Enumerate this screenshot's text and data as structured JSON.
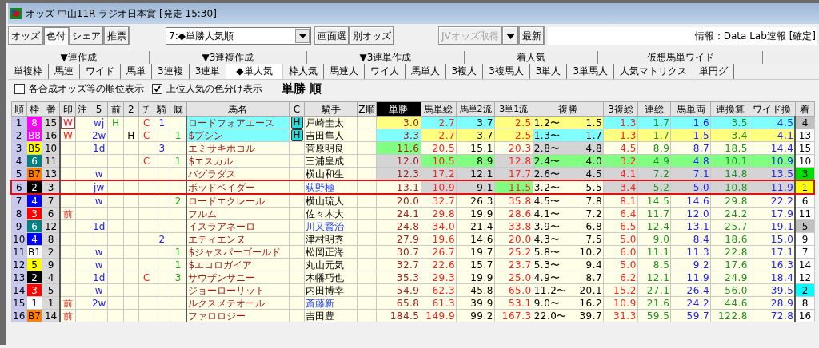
{
  "window": {
    "title": "オッズ 中山11R ラジオ日本賞 [発走 15:30]"
  },
  "toolbar": {
    "mode_buttons": [
      {
        "label": "オッズ",
        "selected": false
      },
      {
        "label": "色付",
        "selected": true
      },
      {
        "label": "シェア",
        "selected": false
      },
      {
        "label": "推票",
        "selected": false
      }
    ],
    "view_select": {
      "value": "7:◆単勝人気順"
    },
    "view_buttons": [
      {
        "label": "画面選",
        "disabled": false
      },
      {
        "label": "別オッズ",
        "disabled": false
      }
    ],
    "fetch_button": {
      "label": "JVオッズ取得",
      "disabled": true
    },
    "refresh_button": {
      "label": "最新",
      "disabled": false
    },
    "info": "情報：Data Lab速報 [確定]"
  },
  "tab_groups": [
    {
      "label": "▼連作成"
    },
    {
      "label": "▼3連複作成"
    },
    {
      "label": "▼3連単作成"
    },
    {
      "label": "着人気"
    },
    {
      "label": "仮想馬単ワイド"
    }
  ],
  "tabs": [
    {
      "label": "単複枠",
      "selected": false
    },
    {
      "label": "馬連",
      "selected": false
    },
    {
      "label": "ワイド",
      "selected": false
    },
    {
      "label": "馬単",
      "selected": false
    },
    {
      "label": "3連複",
      "selected": false
    },
    {
      "label": "3連単",
      "selected": false
    },
    {
      "label": "◆単人気",
      "selected": true
    },
    {
      "label": "枠人気",
      "selected": false
    },
    {
      "label": "馬連人",
      "selected": false
    },
    {
      "label": "ワイ人",
      "selected": false
    },
    {
      "label": "馬単人",
      "selected": false
    },
    {
      "label": "3複人",
      "selected": false
    },
    {
      "label": "3複馬人",
      "selected": false
    },
    {
      "label": "3単人",
      "selected": false
    },
    {
      "label": "3単馬人",
      "selected": false
    },
    {
      "label": "人気マトリクス",
      "selected": false
    },
    {
      "label": "単円グ",
      "selected": false
    }
  ],
  "options": {
    "checkboxes": [
      {
        "label": "各合成オッズ等の順位表示",
        "checked": false
      },
      {
        "label": "上位人気の色分け表示",
        "checked": true
      }
    ],
    "heading": "単勝 順"
  },
  "table": {
    "columns": [
      {
        "label": "順",
        "sorted": false
      },
      {
        "label": "枠",
        "sorted": false
      },
      {
        "label": "番",
        "sorted": false
      },
      {
        "label": "印",
        "sorted": false
      },
      {
        "label": "注",
        "sorted": false
      },
      {
        "label": "5",
        "sorted": false
      },
      {
        "label": "前",
        "sorted": false
      },
      {
        "label": "2",
        "sorted": false
      },
      {
        "label": "チ",
        "sorted": false
      },
      {
        "label": "騎",
        "sorted": false
      },
      {
        "label": "厩",
        "sorted": false
      },
      {
        "label": "馬名",
        "sorted": false
      },
      {
        "label": "C",
        "sorted": false
      },
      {
        "label": "騎手",
        "sorted": false
      },
      {
        "label": "Z順",
        "sorted": false
      },
      {
        "label": "単勝",
        "sorted": true
      },
      {
        "label": "馬単総",
        "sorted": false
      },
      {
        "label": "馬単2流",
        "sorted": false
      },
      {
        "label": "3単1流",
        "sorted": false
      },
      {
        "label": "複勝",
        "sorted": false
      },
      {
        "label": "3複総",
        "sorted": false
      },
      {
        "label": "連総",
        "sorted": false
      },
      {
        "label": "馬単両",
        "sorted": false
      },
      {
        "label": "連換算",
        "sorted": false
      },
      {
        "label": "ワイド換",
        "sorted": false
      },
      {
        "label": "着",
        "sorted": false
      }
    ],
    "rows": [
      {
        "rank": "1",
        "waku": {
          "text": "8",
          "color": "#ff00ff"
        },
        "num": "15",
        "mark": {
          "text": "W",
          "boxed": true
        },
        "marks": {
          "go": "wj",
          "mae": "H",
          "chi": "C",
          "ki": "1"
        },
        "name": "ロードフォアエース",
        "name_highlight": true,
        "c": "H",
        "jockey": "戸崎圭太",
        "jockey_marked": false,
        "odds": [
          {
            "value": "3.0",
            "color": "#ffff80"
          },
          {
            "value": "2.7",
            "color": "#80ffff"
          },
          {
            "value": "3.7",
            "color": "#80ffff"
          },
          {
            "value": "2.5",
            "color": "#ffff80"
          },
          {
            "low": "1.2〜",
            "high": "1.5",
            "color": "#ffff80"
          },
          {
            "value": "1.3",
            "color": "#80ffff"
          },
          {
            "value": "1.7",
            "color": "#80ffff"
          },
          {
            "value": "1.6",
            "color": "#80ffff"
          },
          {
            "value": "3.5",
            "color": "#80ffff"
          },
          {
            "value": "4.5",
            "color": "#80ffff"
          }
        ],
        "finish": {
          "text": "4",
          "color": "#c0c0c0"
        },
        "selected": false
      },
      {
        "rank": "2",
        "waku": {
          "text": "B8",
          "color": "#ff00ff"
        },
        "num": "16",
        "mark": {
          "text": "W",
          "boxed": false
        },
        "marks": {
          "go": "2w",
          "ni": "H",
          "chi": "C",
          "kyu": "1"
        },
        "name": "$ブシン",
        "name_highlight": true,
        "c": "H",
        "jockey": "吉田隼人",
        "jockey_marked": false,
        "odds": [
          {
            "value": "3.3",
            "color": "#80ffff"
          },
          {
            "value": "2.7",
            "color": "#ffff80"
          },
          {
            "value": "3.7",
            "color": "#ffff80"
          },
          {
            "value": "2.5",
            "color": "#ffff80"
          },
          {
            "low": "1.3〜",
            "high": "1.7",
            "color": "#80ffff"
          },
          {
            "value": "1.3",
            "color": "#ffff80"
          },
          {
            "value": "1.7",
            "color": "#ffff80"
          },
          {
            "value": "1.5",
            "color": "#ffff80"
          },
          {
            "value": "3.4",
            "color": "#ffff80"
          },
          {
            "value": "4.1",
            "color": "#ffff80"
          }
        ],
        "finish": {
          "text": "13",
          "color": "#ffffff"
        },
        "selected": false
      },
      {
        "rank": "3",
        "waku": {
          "text": "B5",
          "color": "#ffff00"
        },
        "num": "10",
        "marks": {
          "go": "1d",
          "ki": "3"
        },
        "name": "エミサキホコル",
        "name_highlight": false,
        "jockey": "菅原明良",
        "jockey_marked": false,
        "odds": [
          {
            "value": "11.6",
            "color": "#80ff80"
          },
          {
            "value": "20.5",
            "color": "#ffffe8"
          },
          {
            "value": "15.1",
            "color": "#ffffe8"
          },
          {
            "value": "20.3",
            "color": "#ffffe8"
          },
          {
            "low": "2.8〜",
            "high": "4.8",
            "color": "#d4d4d4"
          },
          {
            "value": "4.5",
            "color": "#ffffe8"
          },
          {
            "value": "8.9",
            "color": "#ffffe8"
          },
          {
            "value": "8.7",
            "color": "#ffffe8"
          },
          {
            "value": "18.5",
            "color": "#ffffe8"
          },
          {
            "value": "14.4",
            "color": "#ffffe8"
          }
        ],
        "finish": {
          "text": "15",
          "color": "#ffffff"
        },
        "selected": false
      },
      {
        "rank": "4",
        "waku": {
          "text": "6",
          "color": "#008080"
        },
        "num": "11",
        "marks": {
          "chi": "C",
          "kyu": "1"
        },
        "name": "$エスカル",
        "name_highlight": false,
        "jockey": "三浦皇成",
        "jockey_marked": false,
        "odds": [
          {
            "value": "12.0",
            "color": "#d4d4d4"
          },
          {
            "value": "10.5",
            "color": "#80ff80"
          },
          {
            "value": "8.9",
            "color": "#80ff80"
          },
          {
            "value": "12.8",
            "color": "#d4d4d4"
          },
          {
            "low": "2.4〜",
            "high": "4.0",
            "color": "#80ff80"
          },
          {
            "value": "3.2",
            "color": "#80ff80"
          },
          {
            "value": "4.9",
            "color": "#80ff80"
          },
          {
            "value": "4.8",
            "color": "#80ff80"
          },
          {
            "value": "10.1",
            "color": "#80ff80"
          },
          {
            "value": "10.9",
            "color": "#80ff80"
          }
        ],
        "finish": {
          "text": "10",
          "color": "#ffffff"
        },
        "selected": false
      },
      {
        "rank": "5",
        "waku": {
          "text": "B7",
          "color": "#ff8000"
        },
        "num": "13",
        "marks": {
          "go": "w"
        },
        "name": "バグラダス",
        "name_highlight": false,
        "jockey": "横山和生",
        "jockey_marked": false,
        "odds": [
          {
            "value": "12.3",
            "color": "#d4d4d4"
          },
          {
            "value": "17.2",
            "color": "#d4d4d4"
          },
          {
            "value": "12.1",
            "color": "#d4d4d4"
          },
          {
            "value": "17.7",
            "color": "#d4d4d4"
          },
          {
            "low": "2.6〜",
            "high": "4.5",
            "color": "#d4d4d4"
          },
          {
            "value": "4.1",
            "color": "#d4d4d4"
          },
          {
            "value": "7.2",
            "color": "#d4d4d4"
          },
          {
            "value": "7.1",
            "color": "#d4d4d4"
          },
          {
            "value": "14.8",
            "color": "#d4d4d4"
          },
          {
            "value": "13.5",
            "color": "#d4d4d4"
          }
        ],
        "finish": {
          "text": "3",
          "color": "#00e000"
        },
        "selected": false
      },
      {
        "rank": "6",
        "waku": {
          "text": "2",
          "color": "#000000"
        },
        "num": "3",
        "marks": {
          "go": "jw"
        },
        "name": "ボッドベイダー",
        "name_highlight": false,
        "jockey": "荻野極",
        "jockey_marked": true,
        "odds": [
          {
            "value": "13.1",
            "color": "#ffffe8"
          },
          {
            "value": "10.9",
            "color": "#d4d4d4"
          },
          {
            "value": "9.1",
            "color": "#d4d4d4"
          },
          {
            "value": "11.5",
            "color": "#80ff80"
          },
          {
            "low": "3.2〜",
            "high": "5.5",
            "color": "#ffffe8"
          },
          {
            "value": "3.4",
            "color": "#d4d4d4"
          },
          {
            "value": "5.2",
            "color": "#d4d4d4"
          },
          {
            "value": "5.0",
            "color": "#d4d4d4"
          },
          {
            "value": "10.8",
            "color": "#d4d4d4"
          },
          {
            "value": "11.9",
            "color": "#d4d4d4"
          }
        ],
        "finish": {
          "text": "1",
          "color": "#ffff00"
        },
        "selected": true
      },
      {
        "rank": "7",
        "waku": {
          "text": "4",
          "color": "#0000ff"
        },
        "num": "7",
        "marks": {
          "go": "w",
          "kyu": "2"
        },
        "name": "ロードエクレール",
        "name_highlight": false,
        "jockey": "横山琉人",
        "jockey_marked": false,
        "odds": [
          {
            "value": "20.0",
            "color": "#ffffe8"
          },
          {
            "value": "32.7",
            "color": "#ffffe8"
          },
          {
            "value": "26.3",
            "color": "#ffffe8"
          },
          {
            "value": "35.8",
            "color": "#ffffe8"
          },
          {
            "low": "4.5〜",
            "high": "7.8",
            "color": "#ffffe8"
          },
          {
            "value": "8.1",
            "color": "#ffffe8"
          },
          {
            "value": "14.5",
            "color": "#ffffe8"
          },
          {
            "value": "14.6",
            "color": "#ffffe8"
          },
          {
            "value": "29.8",
            "color": "#ffffe8"
          },
          {
            "value": "22.2",
            "color": "#ffffe8"
          }
        ],
        "finish": {
          "text": "6",
          "color": "#ffffff"
        },
        "selected": false
      },
      {
        "rank": "8",
        "waku": {
          "text": "3",
          "color": "#ff0000"
        },
        "num": "6",
        "mark": {
          "text": "前",
          "boxed": false
        },
        "marks": {},
        "name": "フルム",
        "name_highlight": false,
        "jockey": "佐々木大",
        "jockey_marked": false,
        "odds": [
          {
            "value": "24.1",
            "color": "#ffffe8"
          },
          {
            "value": "29.8",
            "color": "#ffffe8"
          },
          {
            "value": "19.9",
            "color": "#ffffe8"
          },
          {
            "value": "28.6",
            "color": "#ffffe8"
          },
          {
            "low": "4.1〜",
            "high": "7.2",
            "color": "#ffffe8"
          },
          {
            "value": "6.4",
            "color": "#ffffe8"
          },
          {
            "value": "11.7",
            "color": "#ffffe8"
          },
          {
            "value": "12.0",
            "color": "#ffffe8"
          },
          {
            "value": "24.2",
            "color": "#ffffe8"
          },
          {
            "value": "17.9",
            "color": "#ffffe8"
          }
        ],
        "finish": {
          "text": "11",
          "color": "#ffffff"
        },
        "selected": false
      },
      {
        "rank": "9",
        "waku": {
          "text": "6",
          "color": "#008080"
        },
        "num": "12",
        "marks": {
          "go": "1d"
        },
        "name": "イスラアネーロ",
        "name_highlight": false,
        "jockey": "川又賢治",
        "jockey_marked": true,
        "odds": [
          {
            "value": "24.8",
            "color": "#ffffe8"
          },
          {
            "value": "34.0",
            "color": "#ffffe8"
          },
          {
            "value": "21.4",
            "color": "#ffffe8"
          },
          {
            "value": "33.8",
            "color": "#ffffe8"
          },
          {
            "low": "3.9〜",
            "high": "6.8",
            "color": "#ffffe8"
          },
          {
            "value": "6.5",
            "color": "#ffffe8"
          },
          {
            "value": "12.4",
            "color": "#ffffe8"
          },
          {
            "value": "13.1",
            "color": "#ffffe8"
          },
          {
            "value": "25.7",
            "color": "#ffffe8"
          },
          {
            "value": "19.1",
            "color": "#ffffe8"
          }
        ],
        "finish": {
          "text": "5",
          "color": "#c0c0c0"
        },
        "selected": false
      },
      {
        "rank": "10",
        "waku": {
          "text": "4",
          "color": "#0000ff"
        },
        "num": "8",
        "marks": {
          "ki": "2"
        },
        "name": "エティエンヌ",
        "name_highlight": false,
        "jockey": "津村明秀",
        "jockey_marked": false,
        "odds": [
          {
            "value": "27.9",
            "color": "#ffffe8"
          },
          {
            "value": "19.6",
            "color": "#ffffe8"
          },
          {
            "value": "14.6",
            "color": "#ffffe8"
          },
          {
            "value": "20.0",
            "color": "#ffffe8"
          },
          {
            "low": "4.3〜",
            "high": "7.5",
            "color": "#ffffe8"
          },
          {
            "value": "5.0",
            "color": "#ffffe8"
          },
          {
            "value": "9.0",
            "color": "#ffffe8"
          },
          {
            "value": "8.4",
            "color": "#ffffe8"
          },
          {
            "value": "18.6",
            "color": "#ffffe8"
          },
          {
            "value": "15.0",
            "color": "#ffffe8"
          }
        ],
        "finish": {
          "text": "9",
          "color": "#ffffff"
        },
        "selected": false
      },
      {
        "rank": "11",
        "waku": {
          "text": "B1",
          "color": "#ffffff"
        },
        "num": "2",
        "marks": {
          "go": "w",
          "kyu": "1"
        },
        "name": "$ジャスパーゴールド",
        "name_highlight": false,
        "jockey": "松岡正海",
        "jockey_marked": false,
        "odds": [
          {
            "value": "30.7",
            "color": "#ffffe8"
          },
          {
            "value": "26.7",
            "color": "#ffffe8"
          },
          {
            "value": "19.7",
            "color": "#ffffe8"
          },
          {
            "value": "25.2",
            "color": "#ffffe8"
          },
          {
            "low": "5.8〜",
            "high": "10.2",
            "color": "#ffffe8"
          },
          {
            "value": "6.0",
            "color": "#ffffe8"
          },
          {
            "value": "11.1",
            "color": "#ffffe8"
          },
          {
            "value": "11.3",
            "color": "#ffffe8"
          },
          {
            "value": "22.8",
            "color": "#ffffe8"
          },
          {
            "value": "17.1",
            "color": "#ffffe8"
          }
        ],
        "finish": {
          "text": "7",
          "color": "#ffffff"
        },
        "selected": false
      },
      {
        "rank": "12",
        "waku": {
          "text": "5",
          "color": "#ffff00"
        },
        "num": "9",
        "marks": {
          "go": "w",
          "kyu": "1"
        },
        "name": "$エコロガイア",
        "name_highlight": false,
        "jockey": "丸山元気",
        "jockey_marked": false,
        "odds": [
          {
            "value": "32.7",
            "color": "#ffffe8"
          },
          {
            "value": "22.6",
            "color": "#ffffe8"
          },
          {
            "value": "15.7",
            "color": "#ffffe8"
          },
          {
            "value": "23.7",
            "color": "#ffffe8"
          },
          {
            "low": "5.3〜",
            "high": "9.4",
            "color": "#ffffe8"
          },
          {
            "value": "5.0",
            "color": "#ffffe8"
          },
          {
            "value": "8.5",
            "color": "#ffffe8"
          },
          {
            "value": "9.2",
            "color": "#ffffe8"
          },
          {
            "value": "17.6",
            "color": "#ffffe8"
          },
          {
            "value": "16.3",
            "color": "#ffffe8"
          }
        ],
        "finish": {
          "text": "14",
          "color": "#ffffff"
        },
        "selected": false
      },
      {
        "rank": "13",
        "waku": {
          "text": "2",
          "color": "#000000"
        },
        "num": "4",
        "marks": {
          "go": "1d",
          "chi": "C",
          "kyu": "3"
        },
        "name": "サウザンサニー",
        "name_highlight": false,
        "jockey": "木幡巧也",
        "jockey_marked": false,
        "odds": [
          {
            "value": "35.3",
            "color": "#ffffe8"
          },
          {
            "value": "29.3",
            "color": "#ffffe8"
          },
          {
            "value": "19.9",
            "color": "#ffffe8"
          },
          {
            "value": "25.0",
            "color": "#ffffe8"
          },
          {
            "low": "4.9〜",
            "high": "8.7",
            "color": "#ffffe8"
          },
          {
            "value": "6.2",
            "color": "#ffffe8"
          },
          {
            "value": "12.1",
            "color": "#ffffe8"
          },
          {
            "value": "11.9",
            "color": "#ffffe8"
          },
          {
            "value": "24.9",
            "color": "#ffffe8"
          },
          {
            "value": "18.4",
            "color": "#ffffe8"
          }
        ],
        "finish": {
          "text": "12",
          "color": "#ffffff"
        },
        "selected": false
      },
      {
        "rank": "14",
        "waku": {
          "text": "3",
          "color": "#ff0000"
        },
        "num": "5",
        "marks": {
          "go": "w"
        },
        "name": "ジョーローリット",
        "name_highlight": false,
        "jockey": "内田博幸",
        "jockey_marked": false,
        "odds": [
          {
            "value": "54.9",
            "color": "#ffffe8"
          },
          {
            "value": "62.3",
            "color": "#ffffe8"
          },
          {
            "value": "45.8",
            "color": "#ffffe8"
          },
          {
            "value": "65.0",
            "color": "#ffffe8"
          },
          {
            "low": "11.2〜",
            "high": "20.1",
            "color": "#ffffe8"
          },
          {
            "value": "15.2",
            "color": "#ffffe8"
          },
          {
            "value": "27.1",
            "color": "#ffffe8"
          },
          {
            "value": "26.4",
            "color": "#ffffe8"
          },
          {
            "value": "56.0",
            "color": "#ffffe8"
          },
          {
            "value": "39.5",
            "color": "#ffffe8"
          }
        ],
        "finish": {
          "text": "2",
          "color": "#00ffff"
        },
        "selected": false
      },
      {
        "rank": "15",
        "waku": {
          "text": "1",
          "color": "#ffffff"
        },
        "num": "1",
        "mark": {
          "text": "前",
          "boxed": false
        },
        "marks": {
          "go": "2w"
        },
        "name": "ルクスメテオール",
        "name_highlight": false,
        "jockey": "斎藤新",
        "jockey_marked": true,
        "odds": [
          {
            "value": "65.8",
            "color": "#ffffe8"
          },
          {
            "value": "61.3",
            "color": "#ffffe8"
          },
          {
            "value": "39.9",
            "color": "#ffffe8"
          },
          {
            "value": "53.1",
            "color": "#ffffe8"
          },
          {
            "low": "9.0〜",
            "high": "16.2",
            "color": "#ffffe8"
          },
          {
            "value": "10.9",
            "color": "#ffffe8"
          },
          {
            "value": "21.6",
            "color": "#ffffe8"
          },
          {
            "value": "24.2",
            "color": "#ffffe8"
          },
          {
            "value": "44.6",
            "color": "#ffffe8"
          },
          {
            "value": "28.9",
            "color": "#ffffe8"
          }
        ],
        "finish": {
          "text": "8",
          "color": "#ffffff"
        },
        "selected": false
      },
      {
        "rank": "16",
        "waku": {
          "text": "B7",
          "color": "#ff8000"
        },
        "num": "14",
        "mark": {
          "text": "前",
          "boxed": false
        },
        "marks": {},
        "name": "ファロロジー",
        "name_highlight": false,
        "jockey": "吉田豊",
        "jockey_marked": false,
        "odds": [
          {
            "value": "184.5",
            "color": "#ffffe8"
          },
          {
            "value": "149.9",
            "color": "#ffffe8"
          },
          {
            "value": "99.2",
            "color": "#ffffe8"
          },
          {
            "value": "167.3",
            "color": "#ffffe8"
          },
          {
            "low": "22.0〜",
            "high": "39.7",
            "color": "#ffffe8"
          },
          {
            "value": "31.3",
            "color": "#ffffe8"
          },
          {
            "value": "59.5",
            "color": "#ffffe8"
          },
          {
            "value": "59.7",
            "color": "#ffffe8"
          },
          {
            "value": "122.8",
            "color": "#ffffe8"
          },
          {
            "value": "72.8",
            "color": "#ffffe8"
          }
        ],
        "finish": {
          "text": "16",
          "color": "#ffffff"
        },
        "selected": false
      }
    ]
  }
}
